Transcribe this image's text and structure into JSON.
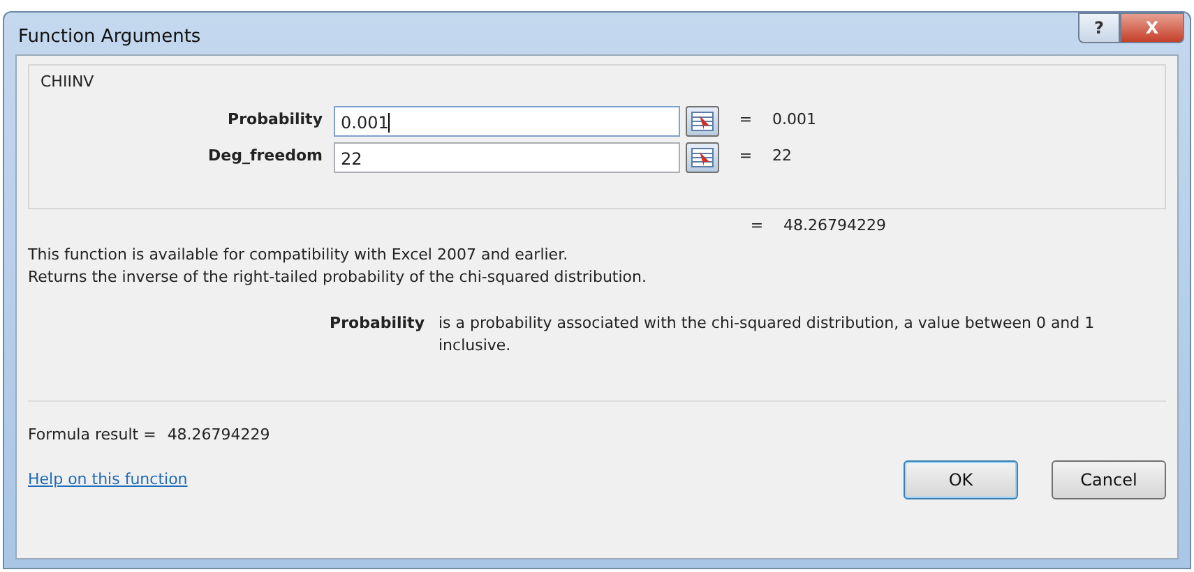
{
  "window": {
    "title": "Function Arguments",
    "title_buttons": [
      {
        "kind": "help",
        "label": "?"
      },
      {
        "kind": "close",
        "label": "X"
      }
    ]
  },
  "function_group": {
    "name": "CHIINV",
    "arguments": [
      {
        "label": "Probability",
        "value": "0.001",
        "focused": true,
        "equals": "=",
        "result": "0.001"
      },
      {
        "label": "Deg_freedom",
        "value": "22",
        "focused": false,
        "equals": "=",
        "result": "22"
      }
    ],
    "equals": "=",
    "result": "48.26794229"
  },
  "description": [
    "This function is available for compatibility with Excel 2007 and earlier.",
    "Returns the inverse of the right-tailed probability of the chi-squared distribution."
  ],
  "argument_help": {
    "label": "Probability",
    "text": "is a probability associated with the chi-squared distribution, a value between 0 and 1 inclusive."
  },
  "formula_result": {
    "label": "Formula result =",
    "value": "48.26794229"
  },
  "help_link": "Help on this function",
  "buttons": [
    {
      "label": "OK",
      "default": true
    },
    {
      "label": "Cancel",
      "default": false
    }
  ]
}
